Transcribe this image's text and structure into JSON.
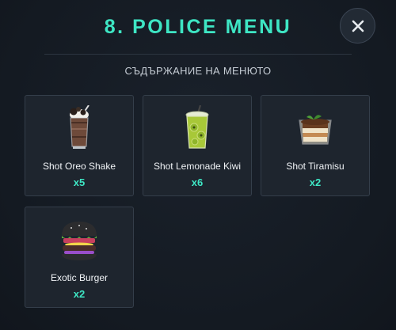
{
  "header": {
    "title": "8. POLICE MENU",
    "close_icon": "close-icon"
  },
  "subtitle": "СЪДЪРЖАНИЕ НА МЕНЮТО",
  "accent_color": "#3ee6c4",
  "items": [
    {
      "name": "Shot Oreo Shake",
      "qty": "x5",
      "icon": "oreo-shake-icon"
    },
    {
      "name": "Shot Lemonade Kiwi",
      "qty": "x6",
      "icon": "lemonade-kiwi-icon"
    },
    {
      "name": "Shot Tiramisu",
      "qty": "x2",
      "icon": "tiramisu-icon"
    },
    {
      "name": "Exotic Burger",
      "qty": "x2",
      "icon": "burger-icon"
    }
  ]
}
